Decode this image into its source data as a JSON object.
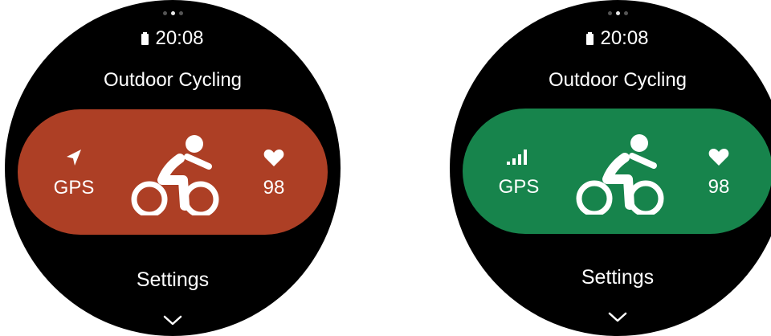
{
  "screens": [
    {
      "state": "gps-searching",
      "time": "20:08",
      "title": "Outdoor Cycling",
      "gps_label": "GPS",
      "gps_icon": "location-arrow-icon",
      "heart_rate": "98",
      "heart_icon": "heart-icon",
      "settings_label": "Settings",
      "pill_color": "#ad3f25",
      "page_indicator": {
        "count": 3,
        "active": 1
      }
    },
    {
      "state": "gps-connected",
      "time": "20:08",
      "title": "Outdoor Cycling",
      "gps_label": "GPS",
      "gps_icon": "signal-bars-icon",
      "heart_rate": "98",
      "heart_icon": "heart-icon",
      "settings_label": "Settings",
      "pill_color": "#17844c",
      "page_indicator": {
        "count": 3,
        "active": 1
      }
    }
  ]
}
